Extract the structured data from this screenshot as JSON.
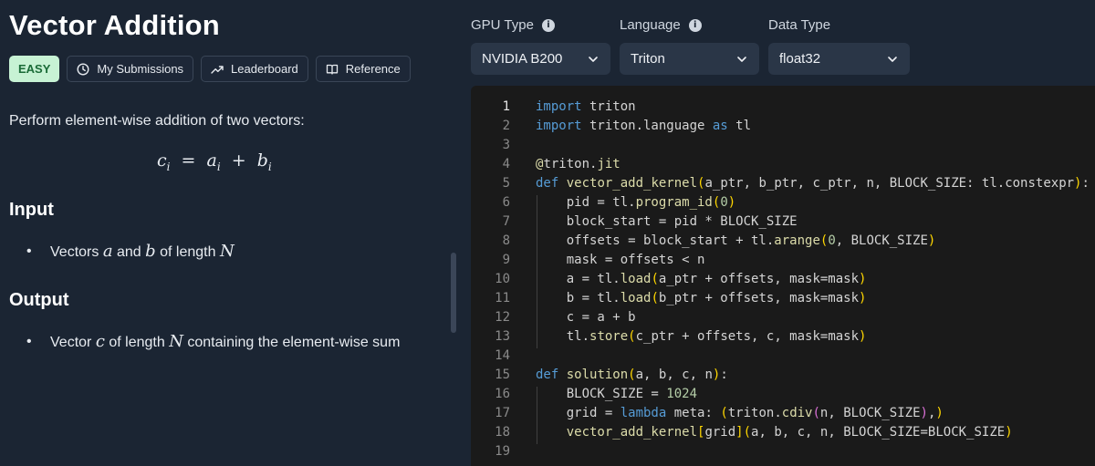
{
  "problem": {
    "title": "Vector Addition",
    "difficulty": "EASY",
    "buttons": [
      {
        "label": "My Submissions",
        "icon": "clock-icon"
      },
      {
        "label": "Leaderboard",
        "icon": "trending-up-icon"
      },
      {
        "label": "Reference",
        "icon": "book-icon"
      }
    ],
    "intro": "Perform element-wise addition of two vectors:",
    "formula": {
      "lhs": "c",
      "lhs_sub": "i",
      "op": "=",
      "a": "a",
      "a_sub": "i",
      "plus": "+",
      "b": "b",
      "b_sub": "i"
    },
    "input_heading": "Input",
    "input_bullet": {
      "t1": "Vectors ",
      "m1": "a",
      "t2": " and ",
      "m2": "b",
      "t3": " of length ",
      "m3": "N"
    },
    "output_heading": "Output",
    "output_bullet": {
      "t1": "Vector ",
      "m1": "c",
      "t2": " of length ",
      "m2": "N",
      "t3": " containing the element-wise sum"
    }
  },
  "settings": {
    "gpu_type": {
      "label": "GPU Type",
      "value": "NVIDIA B200"
    },
    "language": {
      "label": "Language",
      "value": "Triton"
    },
    "data_type": {
      "label": "Data Type",
      "value": "float32"
    }
  },
  "editor": {
    "line_numbers": [
      "1",
      "2",
      "3",
      "4",
      "5",
      "6",
      "7",
      "8",
      "9",
      "10",
      "11",
      "12",
      "13",
      "14",
      "15",
      "16",
      "17",
      "18",
      "19"
    ],
    "active_line": 1,
    "lines": [
      "import triton",
      "import triton.language as tl",
      "",
      "@triton.jit",
      "def vector_add_kernel(a_ptr, b_ptr, c_ptr, n, BLOCK_SIZE: tl.constexpr):",
      "    pid = tl.program_id(0)",
      "    block_start = pid * BLOCK_SIZE",
      "    offsets = block_start + tl.arange(0, BLOCK_SIZE)",
      "    mask = offsets < n",
      "    a = tl.load(a_ptr + offsets, mask=mask)",
      "    b = tl.load(b_ptr + offsets, mask=mask)",
      "    c = a + b",
      "    tl.store(c_ptr + offsets, c, mask=mask)",
      "",
      "def solution(a, b, c, n):",
      "    BLOCK_SIZE = 1024",
      "    grid = lambda meta: (triton.cdiv(n, BLOCK_SIZE),)",
      "    vector_add_kernel[grid](a, b, c, n, BLOCK_SIZE=BLOCK_SIZE)",
      ""
    ]
  },
  "colors": {
    "background": "#1b2533",
    "editor_background": "#1a1a1a",
    "easy_badge": "#c7f2d4",
    "keyword": "#569cd6",
    "function": "#dcdcaa",
    "number": "#b5cea8"
  }
}
